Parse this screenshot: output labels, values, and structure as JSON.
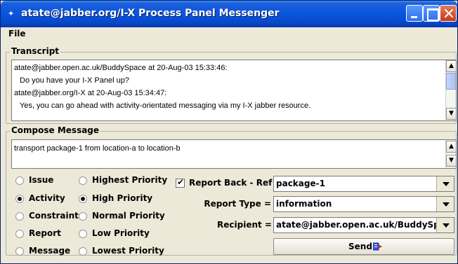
{
  "window": {
    "title": "atate@jabber.org/I-X Process Panel Messenger",
    "title_icon": "feather-icon"
  },
  "menu": {
    "file": "File"
  },
  "transcript": {
    "label": "Transcript",
    "lines": [
      "atate@jabber.open.ac.uk/BuddySpace at 20-Aug-03 15:33:46:",
      "  Do you have your I-X Panel up?",
      "atate@jabber.org/I-X at 20-Aug-03 15:34:47:",
      "  Yes, you can go ahead with activity-orientated messaging via my I-X jabber resource."
    ]
  },
  "compose": {
    "label": "Compose Message",
    "text": "transport package-1 from location-a to location-b"
  },
  "message_types": [
    {
      "label": "Issue",
      "selected": false
    },
    {
      "label": "Activity",
      "selected": true
    },
    {
      "label": "Constraint",
      "selected": false
    },
    {
      "label": "Report",
      "selected": false
    },
    {
      "label": "Message",
      "selected": false
    }
  ],
  "priorities": [
    {
      "label": "Highest Priority",
      "selected": false
    },
    {
      "label": "High Priority",
      "selected": true
    },
    {
      "label": "Normal Priority",
      "selected": false
    },
    {
      "label": "Low Priority",
      "selected": false
    },
    {
      "label": "Lowest Priority",
      "selected": false
    }
  ],
  "report_back": {
    "label": "Report Back - Ref =",
    "checked": true,
    "value": "package-1"
  },
  "report_type": {
    "label": "Report Type =",
    "value": "information"
  },
  "recipient": {
    "label": "Recipient =",
    "value": "atate@jabber.open.ac.uk/BuddySpace"
  },
  "send": {
    "label": "Send",
    "icon": "send-icon"
  }
}
